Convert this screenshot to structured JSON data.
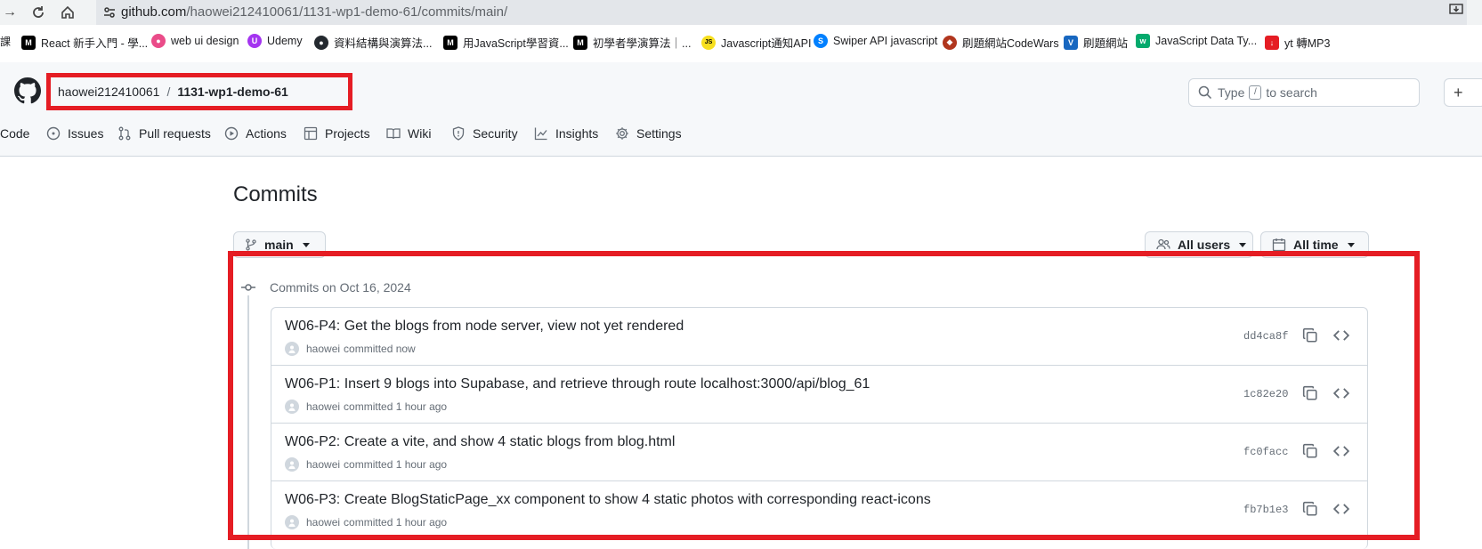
{
  "browser": {
    "url_host": "github.com",
    "url_path": "/haowei212410061/1131-wp1-demo-61/commits/main/"
  },
  "bookmarks": [
    {
      "label": "React 新手入門 - 學...",
      "icon": "medium-icon",
      "color": "#000000",
      "glyph": "M"
    },
    {
      "label": "web ui design",
      "icon": "dribbble-icon",
      "color": "#ea4c89",
      "glyph": "●"
    },
    {
      "label": "Udemy",
      "icon": "udemy-icon",
      "color": "#a435f0",
      "glyph": "U"
    },
    {
      "label": "資料結構與演算法...",
      "icon": "github-icon",
      "color": "#24292f",
      "glyph": "●"
    },
    {
      "label": "用JavaScript學習資...",
      "icon": "medium-icon",
      "color": "#000000",
      "glyph": "M"
    },
    {
      "label": "初學者學演算法｜...",
      "icon": "medium-icon",
      "color": "#000000",
      "glyph": "M"
    },
    {
      "label": "Javascript通知API",
      "icon": "js-icon",
      "color": "#f7df1e",
      "glyph": "JS"
    },
    {
      "label": "Swiper API javascript",
      "icon": "swiper-icon",
      "color": "#0080ff",
      "glyph": "S"
    },
    {
      "label": "刷題網站CodeWars",
      "icon": "codewars-icon",
      "color": "#b1361e",
      "glyph": "◆"
    },
    {
      "label": "刷題網站",
      "icon": "vuetify-icon",
      "color": "#1867c0",
      "glyph": "V"
    },
    {
      "label": "JavaScript Data Ty...",
      "icon": "w3schools-icon",
      "color": "#04aa6d",
      "glyph": "w"
    },
    {
      "label": "yt 轉MP3",
      "icon": "download-icon",
      "color": "#e51d24",
      "glyph": "↓"
    }
  ],
  "repo": {
    "owner": "haowei212410061",
    "separator": "/",
    "name": "1131-wp1-demo-61"
  },
  "search": {
    "prefix": "Type",
    "key": "/",
    "suffix": "to search"
  },
  "tabs": [
    {
      "label": "Code",
      "icon": "code-icon"
    },
    {
      "label": "Issues",
      "icon": "issue-icon"
    },
    {
      "label": "Pull requests",
      "icon": "pull-request-icon"
    },
    {
      "label": "Actions",
      "icon": "play-icon"
    },
    {
      "label": "Projects",
      "icon": "table-icon"
    },
    {
      "label": "Wiki",
      "icon": "book-icon"
    },
    {
      "label": "Security",
      "icon": "shield-icon"
    },
    {
      "label": "Insights",
      "icon": "graph-icon"
    },
    {
      "label": "Settings",
      "icon": "gear-icon"
    }
  ],
  "page": {
    "title": "Commits",
    "branch": "main",
    "users_filter": "All users",
    "time_filter": "All time",
    "group_label": "Commits on Oct 16, 2024"
  },
  "commits": [
    {
      "title": "W06-P4: Get the blogs from node server, view not yet rendered",
      "author": "haowei",
      "when": "committed now",
      "sha": "dd4ca8f"
    },
    {
      "title": "W06-P1: Insert 9 blogs into Supabase, and retrieve through route localhost:3000/api/blog_61",
      "author": "haowei",
      "when": "committed 1 hour ago",
      "sha": "1c82e20"
    },
    {
      "title": "W06-P2: Create a vite, and show 4 static blogs from blog.html",
      "author": "haowei",
      "when": "committed 1 hour ago",
      "sha": "fc0facc"
    },
    {
      "title": "W06-P3: Create BlogStaticPage_xx component to show 4 static photos with corresponding react-icons",
      "author": "haowei",
      "when": "committed 1 hour ago",
      "sha": "fb7b1e3"
    }
  ],
  "colors": {
    "annotation_red": "#e51d24",
    "border": "#d0d7de",
    "muted_text": "#656d76"
  }
}
